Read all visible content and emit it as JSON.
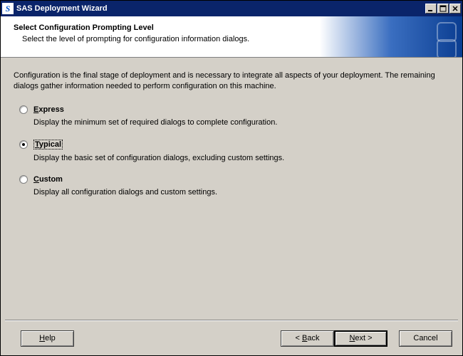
{
  "window": {
    "title": "SAS Deployment Wizard",
    "icon_letter": "S"
  },
  "header": {
    "title": "Select Configuration Prompting Level",
    "subtitle": "Select the level of prompting for configuration information dialogs."
  },
  "intro": "Configuration is the final stage of deployment and is necessary to integrate all aspects of your deployment.  The remaining dialogs gather information needed to perform configuration on this machine.",
  "options": [
    {
      "label": "Express",
      "desc": "Display the minimum set of required dialogs to complete configuration.",
      "selected": false
    },
    {
      "label": "Typical",
      "desc": "Display the basic set of configuration dialogs, excluding custom settings.",
      "selected": true
    },
    {
      "label": "Custom",
      "desc": "Display all configuration dialogs and custom settings.",
      "selected": false
    }
  ],
  "buttons": {
    "help": "Help",
    "back": "< Back",
    "next": "Next >",
    "cancel": "Cancel"
  }
}
